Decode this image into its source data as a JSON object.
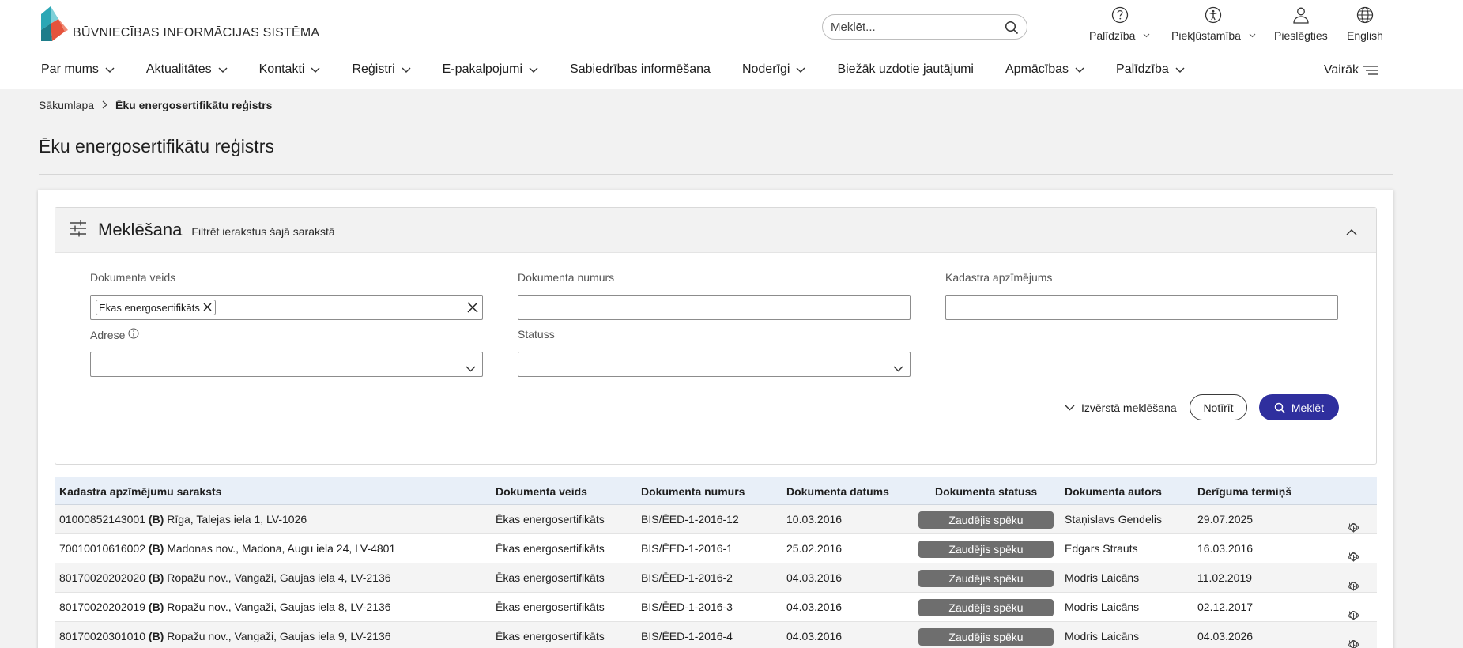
{
  "header": {
    "logo_text": "BŪVNIECĪBAS INFORMĀCIJAS SISTĒMA",
    "search_placeholder": "Meklēt...",
    "utils": [
      {
        "label": "Palīdzība",
        "icon": "help-circle-icon"
      },
      {
        "label": "Piekļūstamība",
        "icon": "accessibility-icon"
      },
      {
        "label": "Pieslēgties",
        "icon": "user-icon"
      },
      {
        "label": "English",
        "icon": "globe-icon"
      }
    ]
  },
  "nav": {
    "items": [
      {
        "label": "Par mums",
        "dropdown": true
      },
      {
        "label": "Aktualitātes",
        "dropdown": true
      },
      {
        "label": "Kontakti",
        "dropdown": true
      },
      {
        "label": "Reģistri",
        "dropdown": true
      },
      {
        "label": "E-pakalpojumi",
        "dropdown": true
      },
      {
        "label": "Sabiedrības informēšana",
        "dropdown": false
      },
      {
        "label": "Noderīgi",
        "dropdown": true
      },
      {
        "label": "Biežāk uzdotie jautājumi",
        "dropdown": false
      },
      {
        "label": "Apmācības",
        "dropdown": true
      },
      {
        "label": "Palīdzība",
        "dropdown": true
      }
    ],
    "more_label": "Vairāk"
  },
  "breadcrumb": {
    "home": "Sākumlapa",
    "current": "Ēku energosertifikātu reģistrs"
  },
  "page_title": "Ēku energosertifikātu reģistrs",
  "search_panel": {
    "title": "Meklēšana",
    "subtitle": "Filtrēt ierakstus šajā sarakstā",
    "fields": {
      "doc_type": {
        "label": "Dokumenta veids",
        "chip": "Ēkas energosertifikāts"
      },
      "doc_number": {
        "label": "Dokumenta numurs",
        "value": ""
      },
      "cadastre": {
        "label": "Kadastra apzīmējums",
        "value": ""
      },
      "address": {
        "label": "Adrese",
        "value": ""
      },
      "status": {
        "label": "Statuss",
        "value": ""
      }
    },
    "advanced_label": "Izvērstā meklēšana",
    "clear_label": "Notīrīt",
    "search_label": "Meklēt"
  },
  "table": {
    "columns": [
      "Kadastra apzīmējumu saraksts",
      "Dokumenta veids",
      "Dokumenta numurs",
      "Dokumenta datums",
      "Dokumenta statuss",
      "Dokumenta autors",
      "Derīguma termiņš"
    ],
    "rows": [
      {
        "cadastre": "01000852143001",
        "mark": "(B)",
        "address": "Rīga, Talejas iela 1, LV-1026",
        "type": "Ēkas energosertifikāts",
        "number": "BIS/ĒED-1-2016-12",
        "date": "10.03.2016",
        "status": "Zaudējis spēku",
        "author": "Staņislavs Gendelis",
        "valid": "29.07.2025"
      },
      {
        "cadastre": "70010010616002",
        "mark": "(B)",
        "address": "Madonas nov., Madona, Augu iela 24, LV-4801",
        "type": "Ēkas energosertifikāts",
        "number": "BIS/ĒED-1-2016-1",
        "date": "25.02.2016",
        "status": "Zaudējis spēku",
        "author": "Edgars Strauts",
        "valid": "16.03.2016"
      },
      {
        "cadastre": "80170020202020",
        "mark": "(B)",
        "address": "Ropažu nov., Vangaži, Gaujas iela 4, LV-2136",
        "type": "Ēkas energosertifikāts",
        "number": "BIS/ĒED-1-2016-2",
        "date": "04.03.2016",
        "status": "Zaudējis spēku",
        "author": "Modris Laicāns",
        "valid": "11.02.2019"
      },
      {
        "cadastre": "80170020202019",
        "mark": "(B)",
        "address": "Ropažu nov., Vangaži, Gaujas iela 8, LV-2136",
        "type": "Ēkas energosertifikāts",
        "number": "BIS/ĒED-1-2016-3",
        "date": "04.03.2016",
        "status": "Zaudējis spēku",
        "author": "Modris Laicāns",
        "valid": "02.12.2017"
      },
      {
        "cadastre": "80170020301010",
        "mark": "(B)",
        "address": "Ropažu nov., Vangaži, Gaujas iela 9, LV-2136",
        "type": "Ēkas energosertifikāts",
        "number": "BIS/ĒED-1-2016-4",
        "date": "04.03.2016",
        "status": "Zaudējis spēku",
        "author": "Modris Laicāns",
        "valid": "04.03.2026"
      }
    ],
    "row_actions": [
      "download-icon",
      "history-icon"
    ]
  },
  "colors": {
    "accent": "#2f2f9e",
    "status_badge": "#6e6e6e",
    "page_bg": "#f2f2f2",
    "table_header_bg": "#e8eff8"
  }
}
